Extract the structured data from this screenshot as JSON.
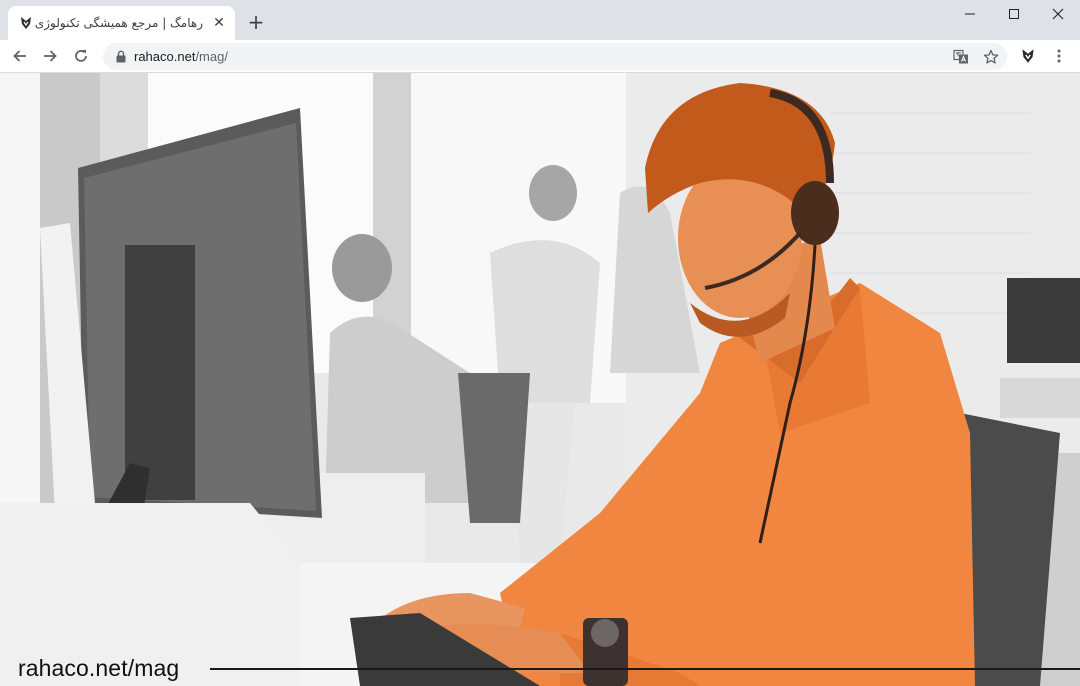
{
  "browser": {
    "tab": {
      "title": "رهامگ | مرجع همیشگی تکنولوژی |",
      "favicon": "rahaco-logo-icon",
      "close_glyph": "✕"
    },
    "new_tab_glyph": "+",
    "window_controls": [
      "minimize-icon",
      "maximize-icon",
      "close-icon"
    ],
    "nav": [
      "back-arrow-icon",
      "forward-arrow-icon",
      "reload-icon"
    ],
    "address": {
      "host": "rahaco.net",
      "path": "/mag/",
      "secure_icon": "lock-icon"
    },
    "toolbar_icons": [
      "translate-icon",
      "bookmark-star-icon",
      "extension-rahaco-icon",
      "menu-dots-icon"
    ]
  },
  "page": {
    "image_subject": "call-center-agent-photo",
    "accent_color": "#f0863f",
    "caption": {
      "site": "rahaco.net/",
      "section": "mag"
    }
  }
}
